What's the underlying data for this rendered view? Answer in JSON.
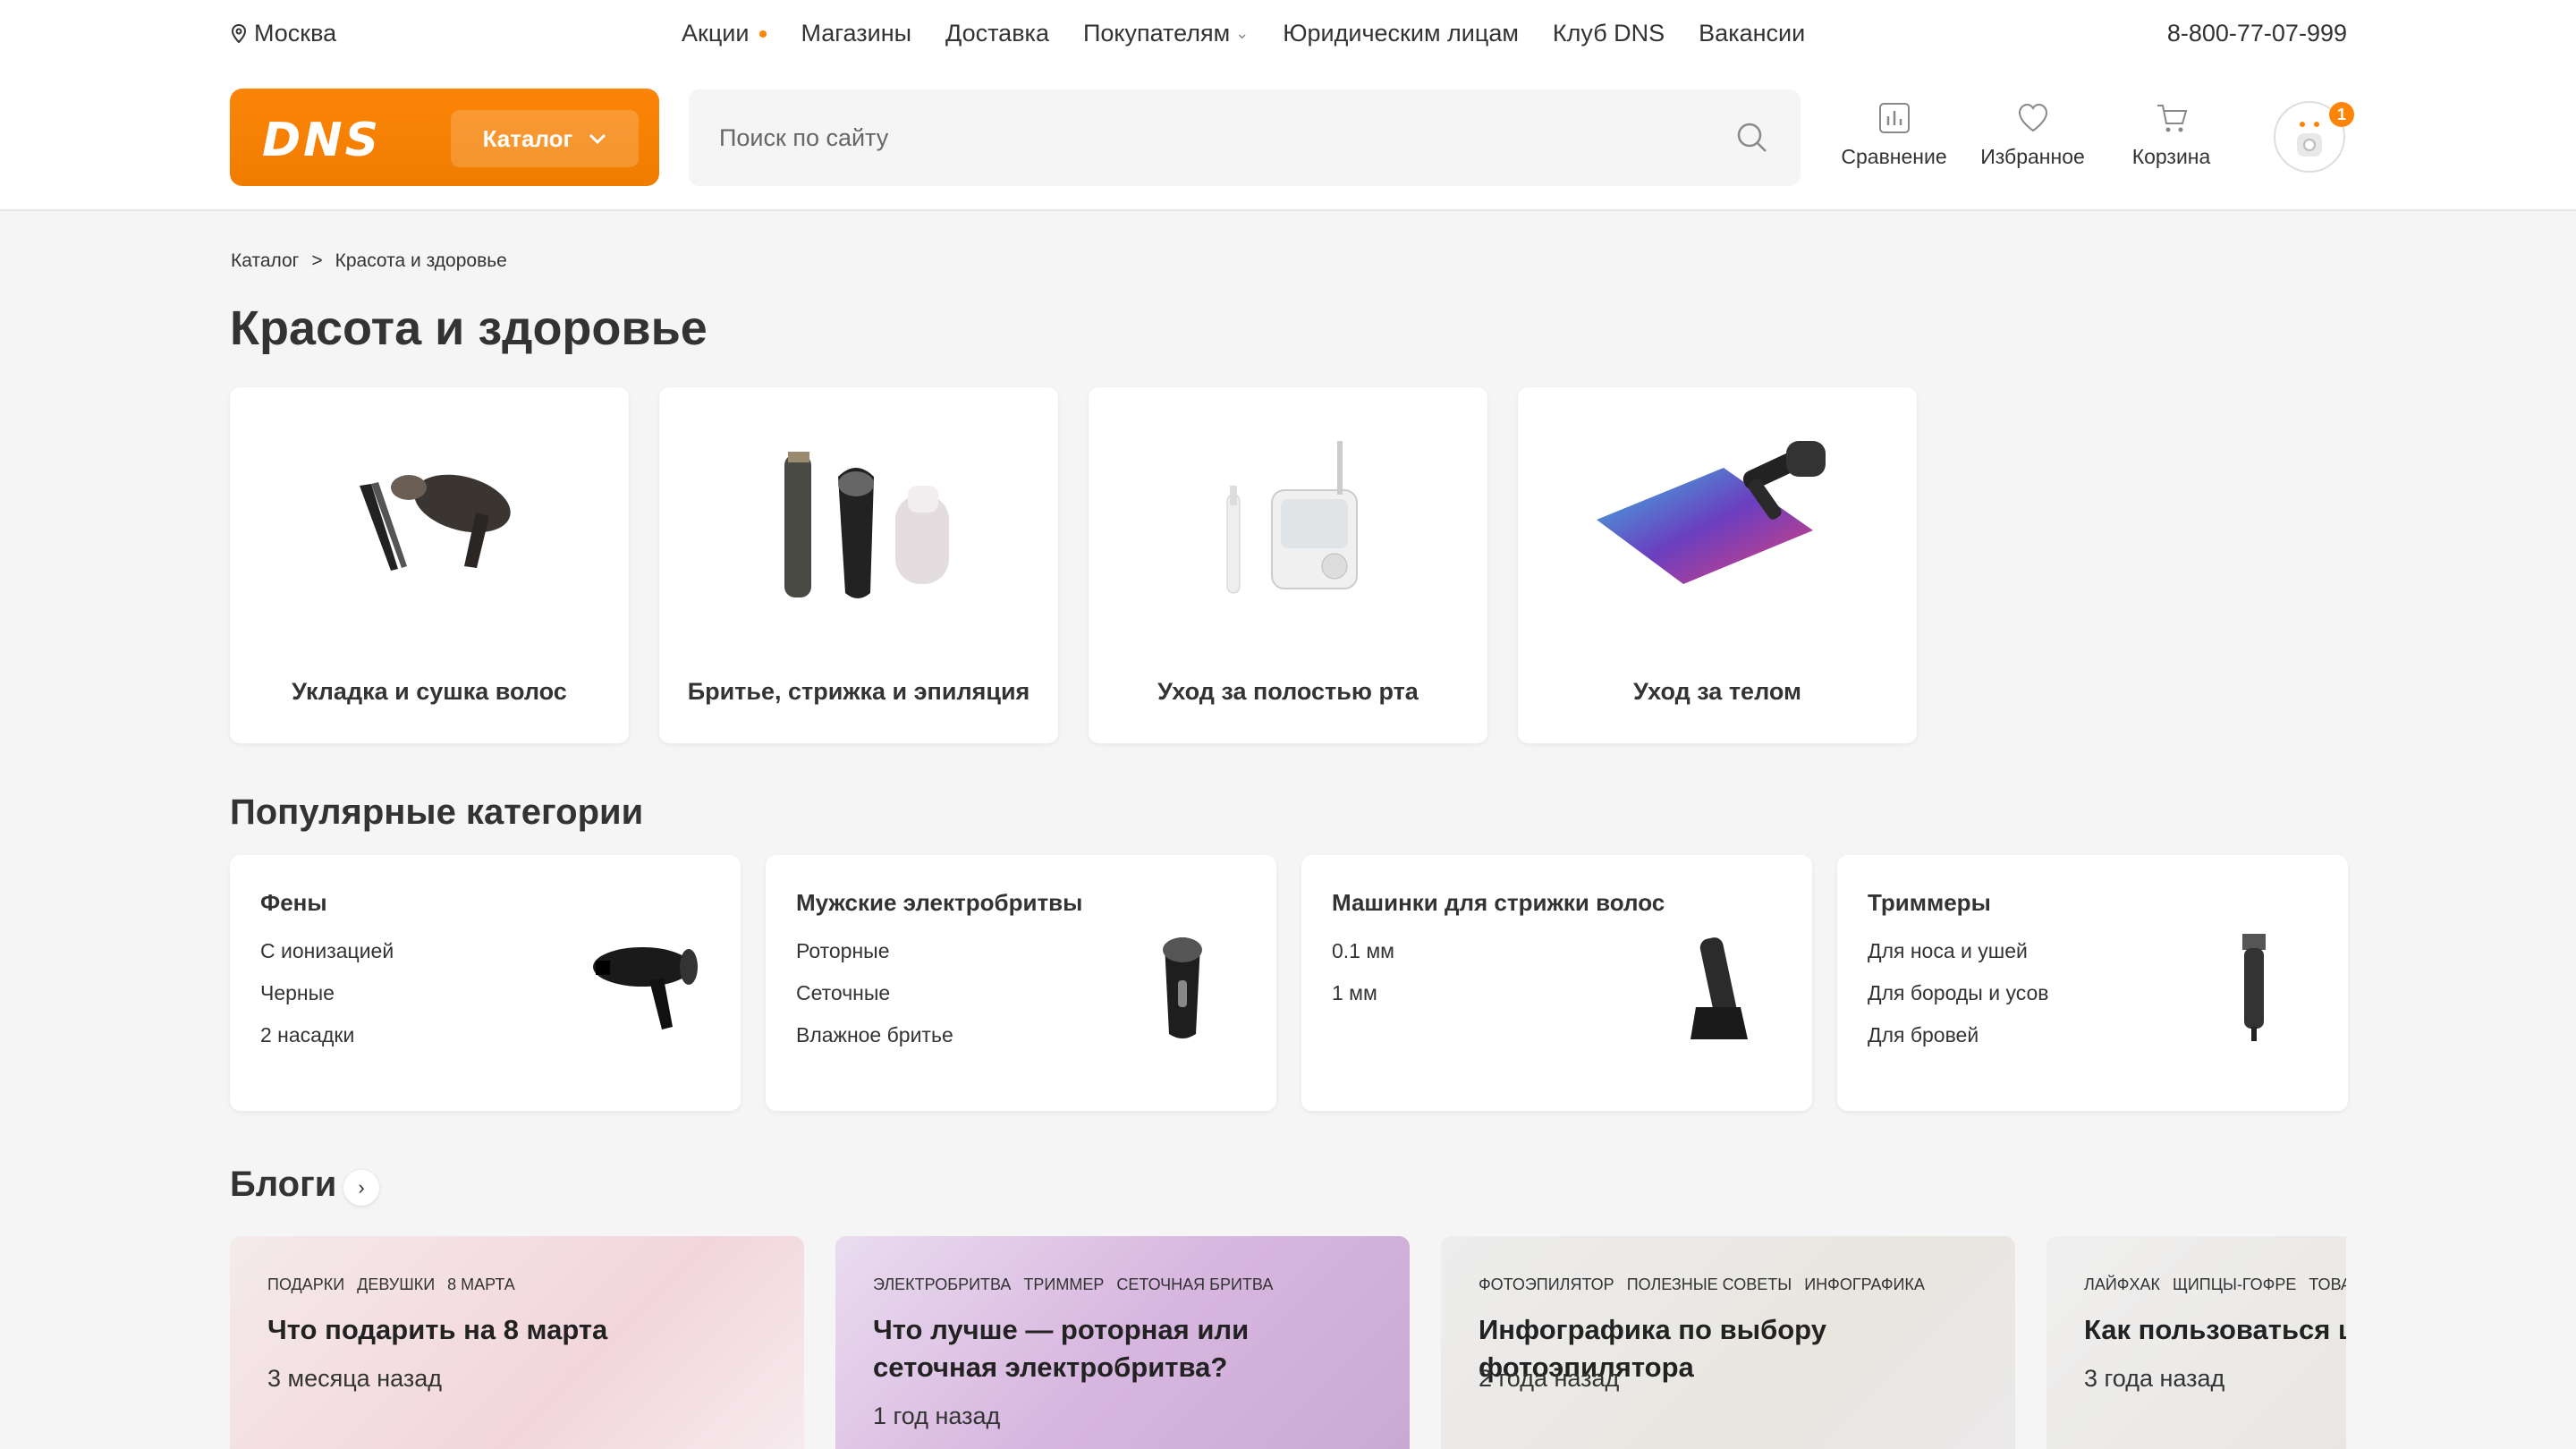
{
  "header": {
    "city": "Москва",
    "nav": [
      {
        "label": "Акции",
        "dot": true
      },
      {
        "label": "Магазины"
      },
      {
        "label": "Доставка"
      },
      {
        "label": "Покупателям",
        "chevron": true
      },
      {
        "label": "Юридическим лицам"
      },
      {
        "label": "Клуб DNS"
      },
      {
        "label": "Вакансии"
      }
    ],
    "phone": "8-800-77-07-999",
    "logo": "DNS",
    "catalog_label": "Каталог",
    "search_placeholder": "Поиск по сайту",
    "tools": {
      "compare": "Сравнение",
      "favorites": "Избранное",
      "cart": "Корзина"
    },
    "avatar_badge": "1",
    "accent": "#fc8507"
  },
  "breadcrumbs": {
    "root": "Каталог",
    "sep": ">",
    "current": "Красота и здоровье"
  },
  "page_title": "Красота и здоровье",
  "categories": [
    {
      "label": "Укладка и сушка волос",
      "icon": "hair-dryer-straightener"
    },
    {
      "label": "Бритье, стрижка и эпиляция",
      "icon": "shaver-trimmer"
    },
    {
      "label": "Уход за полостью рта",
      "icon": "toothbrush-irrigator"
    },
    {
      "label": "Уход за телом",
      "icon": "scale-massage-gun"
    }
  ],
  "popular": {
    "title": "Популярные категории",
    "items": [
      {
        "title": "Фены",
        "links": [
          "С ионизацией",
          "Черные",
          "2 насадки"
        ],
        "icon": "hair-dryer"
      },
      {
        "title": "Мужские электробритвы",
        "links": [
          "Роторные",
          "Сеточные",
          "Влажное бритье"
        ],
        "icon": "electric-shaver"
      },
      {
        "title": "Машинки для стрижки волос",
        "links": [
          "0.1 мм",
          "1 мм"
        ],
        "icon": "hair-clipper"
      },
      {
        "title": "Триммеры",
        "links": [
          "Для носа и ушей",
          "Для бороды и усов",
          "Для бровей"
        ],
        "icon": "trimmer"
      }
    ]
  },
  "blogs": {
    "title": "Блоги",
    "items": [
      {
        "tags": [
          "ПОДАРКИ",
          "ДЕВУШКИ",
          "8 МАРТА"
        ],
        "title": "Что подарить на 8 марта",
        "date": "3 месяца назад"
      },
      {
        "tags": [
          "ЭЛЕКТРОБРИТВА",
          "ТРИММЕР",
          "СЕТОЧНАЯ БРИТВА"
        ],
        "title": "Что лучше — роторная или сеточная электробритва?",
        "date": "1 год назад"
      },
      {
        "tags": [
          "ФОТОЭПИЛЯТОР",
          "ПОЛЕЗНЫЕ СОВЕТЫ",
          "ИНФОГРАФИКА"
        ],
        "title": "Инфографика по выбору фотоэпилятора",
        "date": "2 года назад"
      },
      {
        "tags": [
          "ЛАЙФХАК",
          "ЩИПЦЫ-ГОФРЕ",
          "ТОВАР"
        ],
        "title": "Как пользоваться щипцами-гофре",
        "date": "3 года назад"
      }
    ]
  }
}
